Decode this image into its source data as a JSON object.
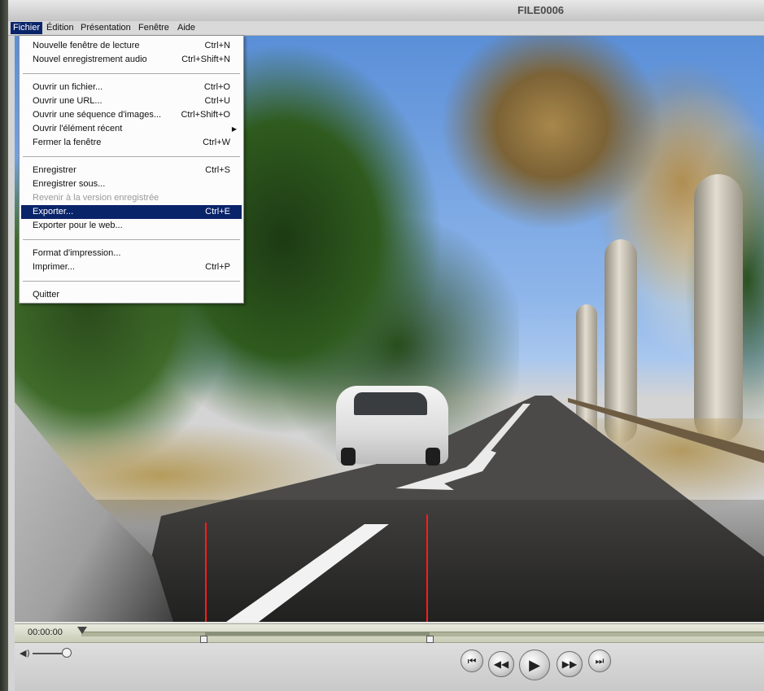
{
  "window": {
    "title": "FILE0006"
  },
  "menubar": [
    "Fichier",
    "Édition",
    "Présentation",
    "Fenêtre",
    "Aide"
  ],
  "file_menu": {
    "groups": [
      [
        {
          "label": "Nouvelle fenêtre de lecture",
          "shortcut": "Ctrl+N"
        },
        {
          "label": "Nouvel enregistrement audio",
          "shortcut": "Ctrl+Shift+N"
        }
      ],
      [
        {
          "label": "Ouvrir un fichier...",
          "shortcut": "Ctrl+O"
        },
        {
          "label": "Ouvrir une URL...",
          "shortcut": "Ctrl+U"
        },
        {
          "label": "Ouvrir une séquence d'images...",
          "shortcut": "Ctrl+Shift+O"
        },
        {
          "label": "Ouvrir l'élément récent",
          "shortcut": "",
          "submenu": true
        },
        {
          "label": "Fermer la fenêtre",
          "shortcut": "Ctrl+W"
        }
      ],
      [
        {
          "label": "Enregistrer",
          "shortcut": "Ctrl+S"
        },
        {
          "label": "Enregistrer sous...",
          "shortcut": ""
        },
        {
          "label": "Revenir à la version enregistrée",
          "shortcut": "",
          "disabled": true
        },
        {
          "label": "Exporter...",
          "shortcut": "Ctrl+E",
          "highlighted": true
        },
        {
          "label": "Exporter pour le web...",
          "shortcut": ""
        }
      ],
      [
        {
          "label": "Format d'impression...",
          "shortcut": ""
        },
        {
          "label": "Imprimer...",
          "shortcut": "Ctrl+P"
        }
      ],
      [
        {
          "label": "Quitter",
          "shortcut": ""
        }
      ]
    ]
  },
  "player": {
    "current_time": "00:00:00",
    "volume_icon": "speaker-icon",
    "transport": [
      {
        "name": "go-to-start-button",
        "icon": "skip-back-icon"
      },
      {
        "name": "rewind-button",
        "icon": "rewind-icon"
      },
      {
        "name": "play-button",
        "icon": "play-icon"
      },
      {
        "name": "fast-forward-button",
        "icon": "fast-forward-icon"
      },
      {
        "name": "go-to-end-button",
        "icon": "skip-forward-icon"
      }
    ]
  },
  "colors": {
    "menu_highlight": "#0a246a",
    "cut_marker": "#ff1a1a"
  }
}
